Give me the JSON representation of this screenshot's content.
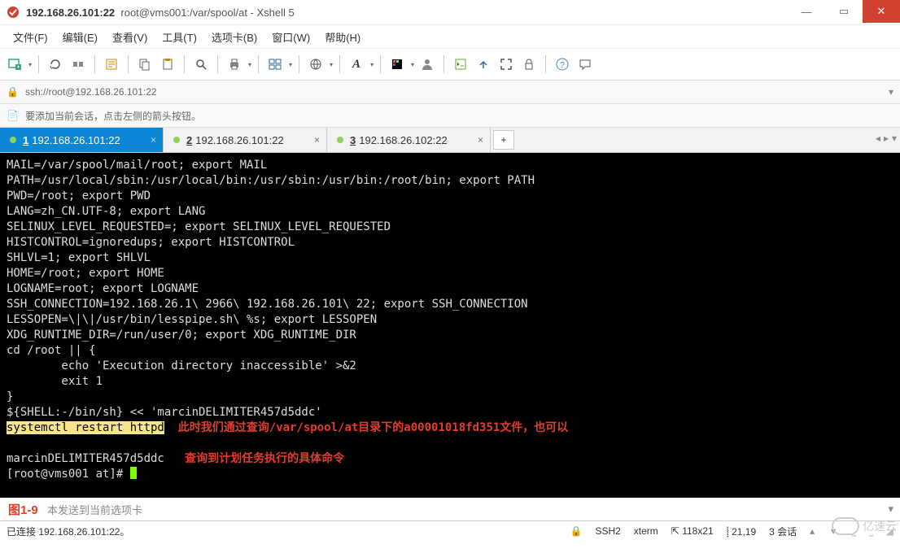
{
  "window": {
    "title_ip": "192.168.26.101:22",
    "title_app": "root@vms001:/var/spool/at - Xshell 5"
  },
  "menu": {
    "file": "文件(F)",
    "edit": "编辑(E)",
    "view": "查看(V)",
    "tools": "工具(T)",
    "tabs": "选项卡(B)",
    "window": "窗口(W)",
    "help": "帮助(H)"
  },
  "address": {
    "icon": "🔒",
    "url": "ssh://root@192.168.26.101:22"
  },
  "info": {
    "icon": "📄",
    "text": "要添加当前会话，点击左侧的箭头按钮。"
  },
  "tabs": [
    {
      "num": "1",
      "label": "192.168.26.101:22",
      "active": true
    },
    {
      "num": "2",
      "label": "192.168.26.101:22",
      "active": false
    },
    {
      "num": "3",
      "label": "192.168.26.102:22",
      "active": false
    }
  ],
  "terminal": {
    "lines": [
      "MAIL=/var/spool/mail/root; export MAIL",
      "PATH=/usr/local/sbin:/usr/local/bin:/usr/sbin:/usr/bin:/root/bin; export PATH",
      "PWD=/root; export PWD",
      "LANG=zh_CN.UTF-8; export LANG",
      "SELINUX_LEVEL_REQUESTED=; export SELINUX_LEVEL_REQUESTED",
      "HISTCONTROL=ignoredups; export HISTCONTROL",
      "SHLVL=1; export SHLVL",
      "HOME=/root; export HOME",
      "LOGNAME=root; export LOGNAME",
      "SSH_CONNECTION=192.168.26.1\\ 2966\\ 192.168.26.101\\ 22; export SSH_CONNECTION",
      "LESSOPEN=\\|\\|/usr/bin/lesspipe.sh\\ %s; export LESSOPEN",
      "XDG_RUNTIME_DIR=/run/user/0; export XDG_RUNTIME_DIR",
      "cd /root || {",
      "        echo 'Execution directory inaccessible' >&2",
      "        exit 1",
      "}",
      "${SHELL:-/bin/sh} << 'marcinDELIMITER457d5ddc'"
    ],
    "hl_cmd": "systemctl restart httpd",
    "note1": "此时我们通过查询/var/spool/at目录下的a00001018fd351文件，也可以",
    "delim": "marcinDELIMITER457d5ddc",
    "note2": "查询到计划任务执行的具体命令",
    "prompt": "[root@vms001 at]# "
  },
  "sendbar": {
    "fig": "图1-9",
    "placeholder": "本发送到当前选项卡"
  },
  "status": {
    "left": "已连接 192.168.26.101:22。",
    "ssh": "SSH2",
    "term": "xterm",
    "size": "118x21",
    "pos": "21,19",
    "sess": "3 会话",
    "lock": "🔒"
  },
  "watermark": "亿速云"
}
